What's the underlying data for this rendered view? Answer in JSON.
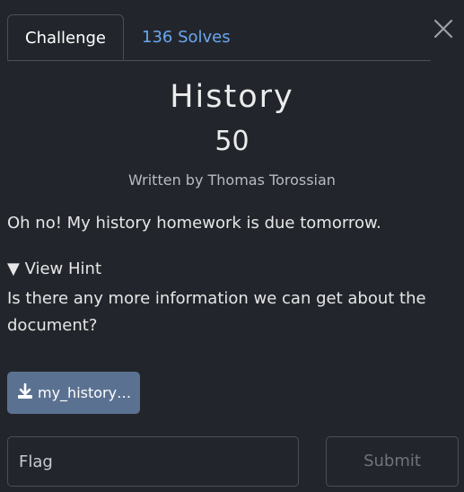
{
  "tabs": {
    "challenge": "Challenge",
    "solves": "136 Solves"
  },
  "challenge": {
    "title": "History",
    "points": "50",
    "author": "Written by Thomas Torossian",
    "description": "Oh no! My history homework is due tomorrow."
  },
  "hint": {
    "toggle_label": "▼ View Hint",
    "text": "Is there any more information we can get about the document?"
  },
  "file": {
    "label": "my_history…"
  },
  "form": {
    "flag_placeholder": "Flag",
    "submit_label": "Submit"
  },
  "colors": {
    "background": "#22262c",
    "link": "#6aa7f0",
    "download_button": "#5b7191"
  },
  "icons": {
    "close": "close-icon",
    "download": "download-icon"
  }
}
